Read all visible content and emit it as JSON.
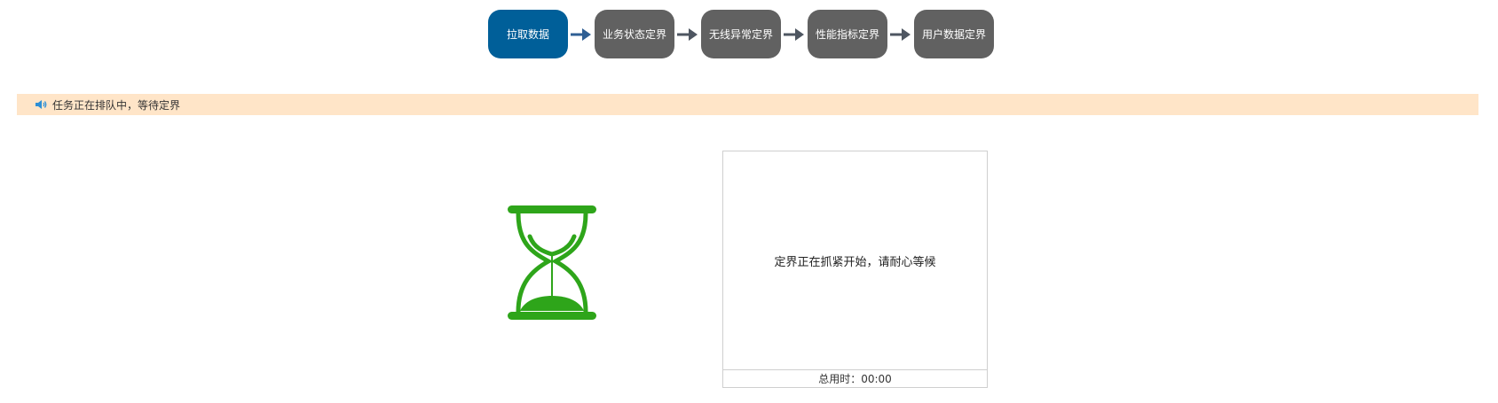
{
  "steps": [
    {
      "label": "拉取数据",
      "active": true
    },
    {
      "label": "业务状态定界",
      "active": false
    },
    {
      "label": "无线异常定界",
      "active": false
    },
    {
      "label": "性能指标定界",
      "active": false
    },
    {
      "label": "用户数据定界",
      "active": false
    }
  ],
  "notice": {
    "icon": "speaker-icon",
    "text": "任务正在排队中，等待定界"
  },
  "waiting": {
    "icon": "hourglass-icon",
    "message": "定界正在抓紧开始，请耐心等候",
    "elapsed_label": "总用时：",
    "elapsed_value": "00:00"
  },
  "colors": {
    "step_active": "#005f99",
    "step_inactive": "#616161",
    "notice_bg": "#ffe5c8",
    "hourglass": "#2ea51a"
  }
}
